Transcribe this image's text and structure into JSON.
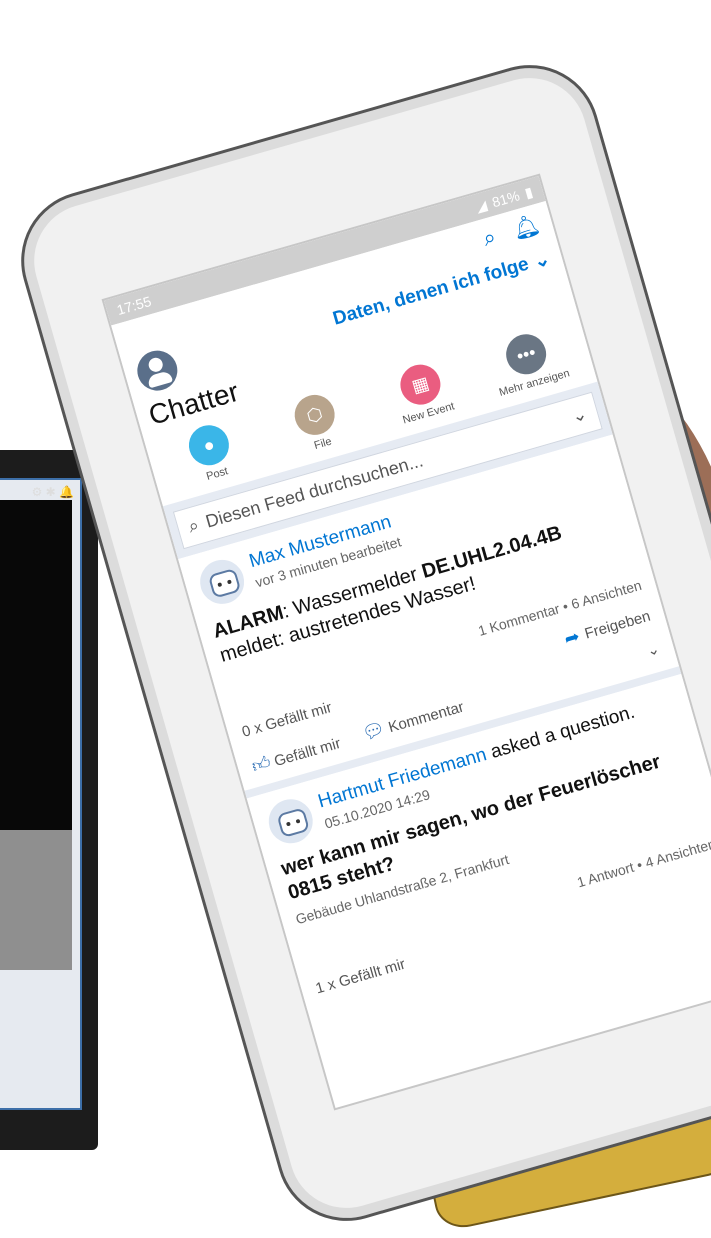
{
  "status_bar": {
    "time": "17:55",
    "battery": "81%"
  },
  "header": {
    "filter_label": "Daten, denen ich folge",
    "title": "Chatter"
  },
  "actions": [
    {
      "label": "Post",
      "color": "#3ab6e8"
    },
    {
      "label": "File",
      "color": "#b8a48c"
    },
    {
      "label": "New Event",
      "color": "#ea5d80"
    },
    {
      "label": "Mehr anzeigen",
      "color": "#6a7684"
    }
  ],
  "search": {
    "placeholder": "Diesen Feed durchsuchen..."
  },
  "posts": [
    {
      "author": "Max Mustermann",
      "meta": "vor 3 minuten bearbeitet",
      "text_bold": "ALARM",
      "text_mid": ": Wassermelder ",
      "text_code": "DE.UHL2.04.4B",
      "text_end": " meldet: austretendes Wasser!",
      "stats": "1 Kommentar • 6 Ansichten",
      "likes": "0 x Gefällt mir",
      "share_label": "Freigeben",
      "like_btn": "Gefällt mir",
      "comment_btn": "Kommentar"
    },
    {
      "author": "Hartmut Friedemann",
      "verb": "asked a question.",
      "timestamp": "05.10.2020 14:29",
      "question": "wer kann mir sagen, wo der Feuerlöscher 0815 steht?",
      "location": "Gebäude Uhlandstraße 2, Frankfurt",
      "stats": "1 Antwort • 4 Ansichten",
      "likes": "1 x Gefällt mir"
    }
  ],
  "laptop": {
    "toolbar_icons": "⚙ ✱ 🔔"
  }
}
